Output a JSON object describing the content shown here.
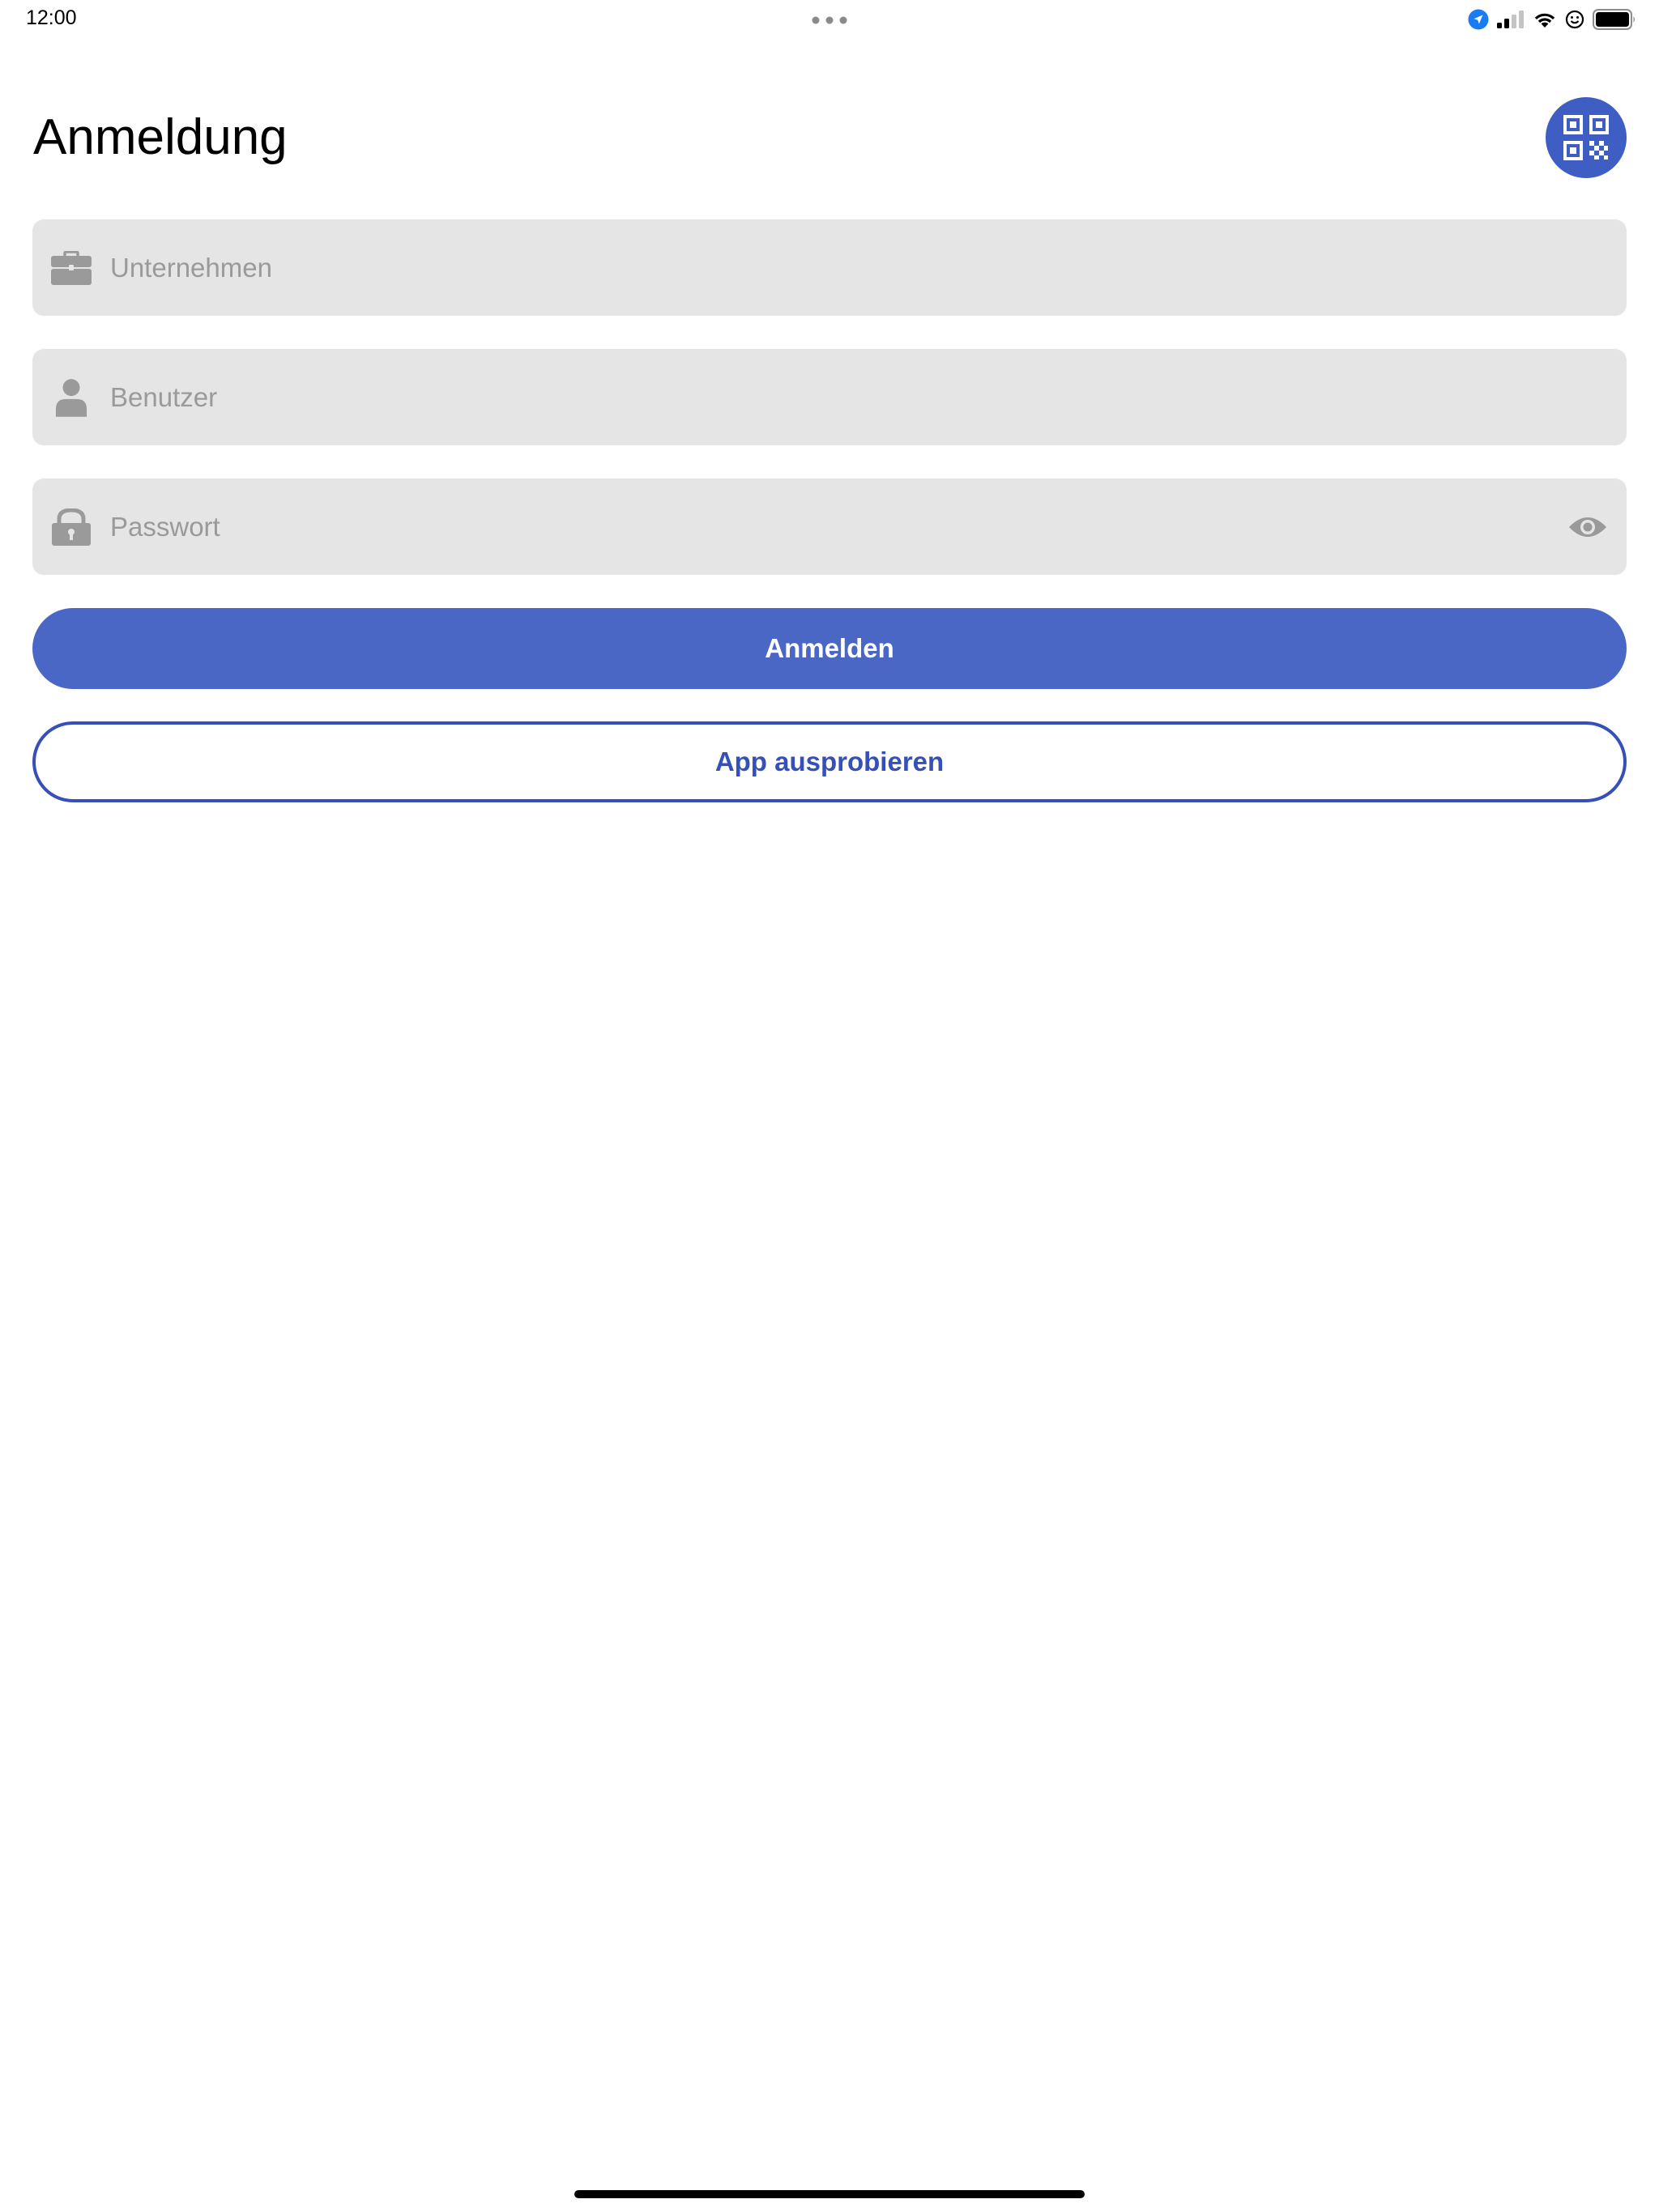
{
  "status_bar": {
    "time": "12:00",
    "icons": [
      "location-icon",
      "cellular-signal-icon",
      "wifi-icon",
      "vpn-face-icon",
      "battery-icon"
    ]
  },
  "header": {
    "title": "Anmeldung",
    "qr_button_icon": "qr-code-icon"
  },
  "form": {
    "company": {
      "icon": "briefcase-icon",
      "value": "",
      "placeholder": "Unternehmen"
    },
    "user": {
      "icon": "person-icon",
      "value": "",
      "placeholder": "Benutzer"
    },
    "password": {
      "icon": "lock-icon",
      "value": "",
      "placeholder": "Passwort",
      "toggle_icon": "eye-icon"
    }
  },
  "buttons": {
    "login_label": "Anmelden",
    "try_app_label": "App ausprobieren"
  },
  "colors": {
    "accent": "#4a67c6",
    "accent_dark": "#3550b8",
    "field_bg": "#e5e5e5",
    "placeholder": "#9a9a9a",
    "icon_gray": "#9a9a9a"
  }
}
